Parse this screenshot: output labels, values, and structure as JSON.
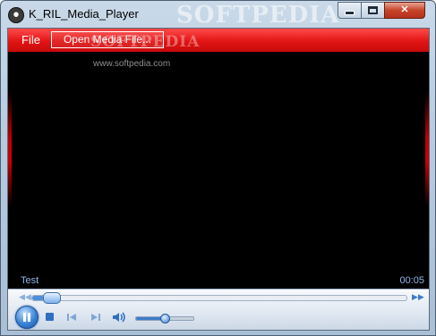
{
  "window": {
    "title": "K_RIL_Media_Player",
    "watermark": "SOFTPEDIA",
    "min_label": "minimize",
    "max_label": "maximize",
    "close_glyph": "✕"
  },
  "menu": {
    "file_label": "File",
    "open_label": "Open Media File..."
  },
  "watermark": {
    "text": "SOFTPEDIA",
    "url": "www.softpedia.com"
  },
  "status": {
    "track_name": "Test",
    "time": "00:05"
  },
  "transport": {
    "seek_position": 0.03,
    "volume_level": 0.5,
    "icons": [
      "rewind-icon",
      "pause-icon",
      "stop-icon",
      "previous-icon",
      "next-icon",
      "speaker-icon",
      "fast-forward-icon"
    ]
  },
  "colors": {
    "menubar": "#e11414",
    "video_bg": "#000000",
    "accent_blue": "#3b82d6",
    "status_text": "#8fb8e8",
    "close_button": "#c7442a"
  }
}
